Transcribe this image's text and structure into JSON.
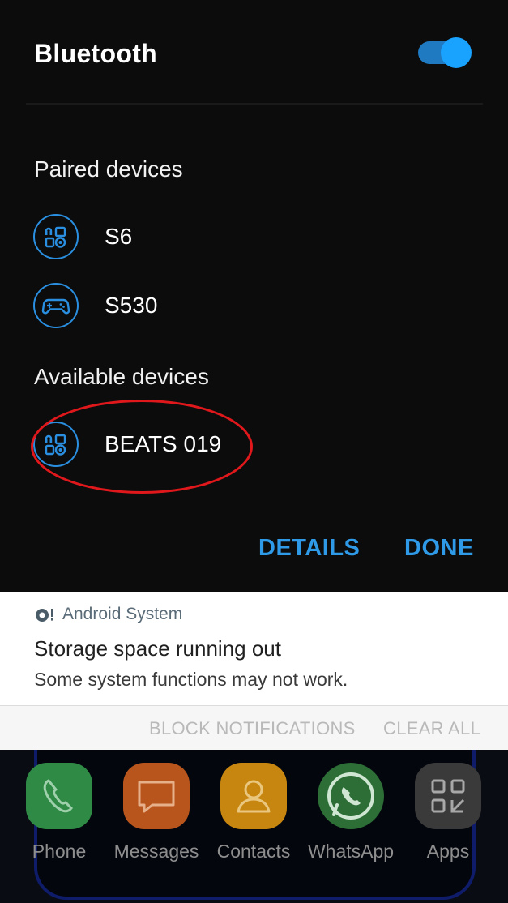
{
  "bluetooth": {
    "title": "Bluetooth",
    "enabled": true,
    "paired_title": "Paired devices",
    "paired_devices": [
      {
        "label": "S6",
        "icon": "device-grid-icon"
      },
      {
        "label": "S530",
        "icon": "gamepad-icon"
      }
    ],
    "available_title": "Available devices",
    "available_devices": [
      {
        "label": "BEATS 019",
        "icon": "device-grid-icon"
      }
    ],
    "details_label": "DETAILS",
    "done_label": "DONE",
    "accent_color": "#2f9ae8",
    "highlight_color": "#e0181c"
  },
  "notification": {
    "app_name": "Android System",
    "title": "Storage space running out",
    "text": "Some system functions may not work.",
    "block_label": "BLOCK NOTIFICATIONS",
    "clear_label": "CLEAR ALL"
  },
  "dock": {
    "apps": [
      {
        "label": "Phone",
        "icon": "phone-icon",
        "color": "#2f8a45"
      },
      {
        "label": "Messages",
        "icon": "messages-icon",
        "color": "#b8551c"
      },
      {
        "label": "Contacts",
        "icon": "contacts-icon",
        "color": "#c7860f"
      },
      {
        "label": "WhatsApp",
        "icon": "whatsapp-icon",
        "color": "#2c6e36"
      },
      {
        "label": "Apps",
        "icon": "apps-grid-icon",
        "color": "#3a3a3a"
      }
    ]
  }
}
